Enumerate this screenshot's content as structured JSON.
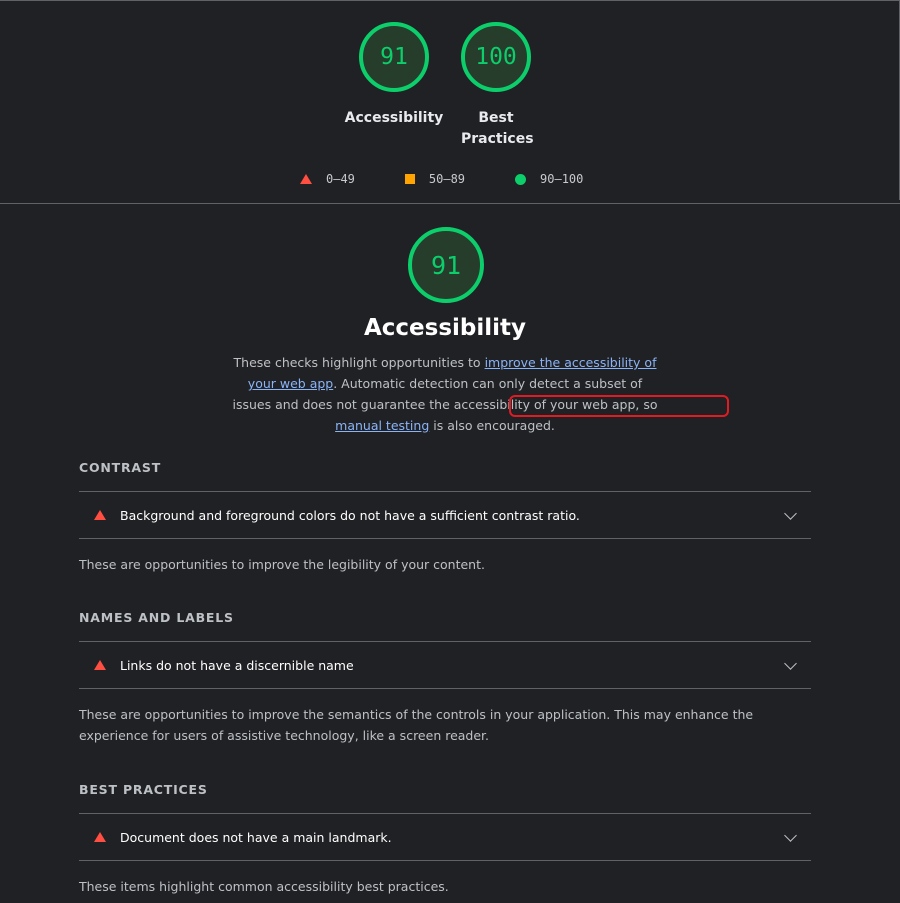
{
  "summary_gauges": [
    {
      "score": "91",
      "label": "Accessibility"
    },
    {
      "score": "100",
      "label": "Best Practices"
    }
  ],
  "legend": [
    {
      "range": "0–49",
      "shape": "triangle",
      "color": "#ff4e42"
    },
    {
      "range": "50–89",
      "shape": "square",
      "color": "#ffa400"
    },
    {
      "range": "90–100",
      "shape": "circle",
      "color": "#0cce6b"
    }
  ],
  "category": {
    "score": "91",
    "title": "Accessibility",
    "description_part1": "These checks highlight opportunities to ",
    "link1": "improve the accessibility of your web app",
    "description_part2": ". Automatic detection can only detect a subset of issues and does not guarantee the accessibility of your web app, so ",
    "link2": "manual testing",
    "description_part3": " is also encouraged."
  },
  "groups": [
    {
      "title": "CONTRAST",
      "audit": "Background and foreground colors do not have a sufficient contrast ratio.",
      "description": "These are opportunities to improve the legibility of your content."
    },
    {
      "title": "NAMES AND LABELS",
      "audit": "Links do not have a discernible name",
      "description": "These are opportunities to improve the semantics of the controls in your application. This may enhance the experience for users of assistive technology, like a screen reader."
    },
    {
      "title": "BEST PRACTICES",
      "audit": "Document does not have a main landmark.",
      "description": "These items highlight common accessibility best practices."
    }
  ],
  "colors": {
    "pass": "#0cce6b",
    "fail": "#ff4e42",
    "average": "#ffa400",
    "link": "#8ab4f8",
    "highlight": "#e01b24"
  }
}
